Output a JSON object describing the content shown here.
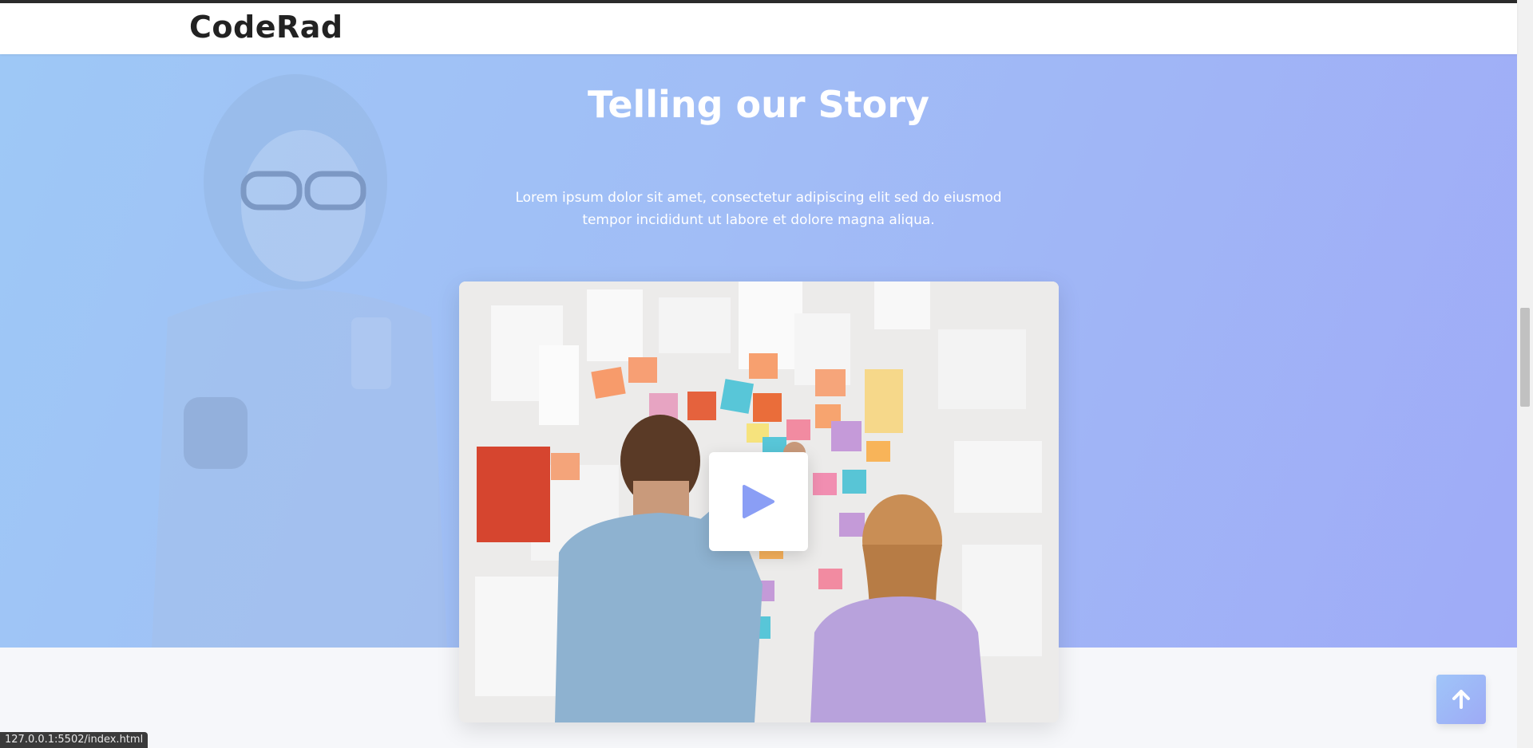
{
  "header": {
    "brand": "CodeRad"
  },
  "hero": {
    "title": "Telling our Story",
    "text_line1": "Lorem ipsum dolor sit amet, consectetur adipiscing elit sed do eiusmod",
    "text_line2": "tempor incididunt ut labore et dolore magna aliqua.",
    "background_colors": [
      "#9ec8f6",
      "#9fabf7"
    ]
  },
  "video": {
    "play_icon": "play-icon",
    "play_color": "#8a9ef5"
  },
  "back_to_top": {
    "icon": "arrow-up-icon"
  },
  "status_bar": {
    "url": "127.0.0.1:5502/index.html"
  }
}
